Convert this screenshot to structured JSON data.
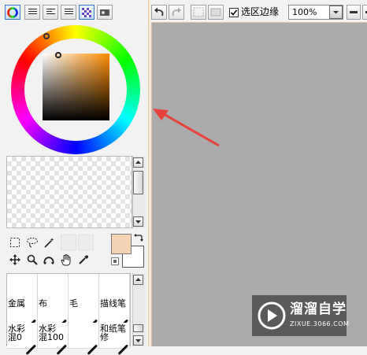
{
  "toolbar": {
    "selection_edge_label": "选区边缘",
    "selection_edge_checked": true,
    "zoom_value": "100%"
  },
  "brushes": [
    {
      "label": "金属"
    },
    {
      "label": "布"
    },
    {
      "label": "毛"
    },
    {
      "label": "描线笔"
    },
    {
      "label": "水彩\n混0"
    },
    {
      "label": "水彩\n混100"
    },
    {
      "label": ""
    },
    {
      "label": "和纸笔\n修"
    }
  ],
  "colors": {
    "foreground": "#f6d4b3",
    "background": "#ffffff",
    "canvas": "#ababab",
    "arrow": "#e8413a"
  },
  "watermark": {
    "title": "溜溜自学",
    "url": "ZIXUE.3066.COM"
  }
}
